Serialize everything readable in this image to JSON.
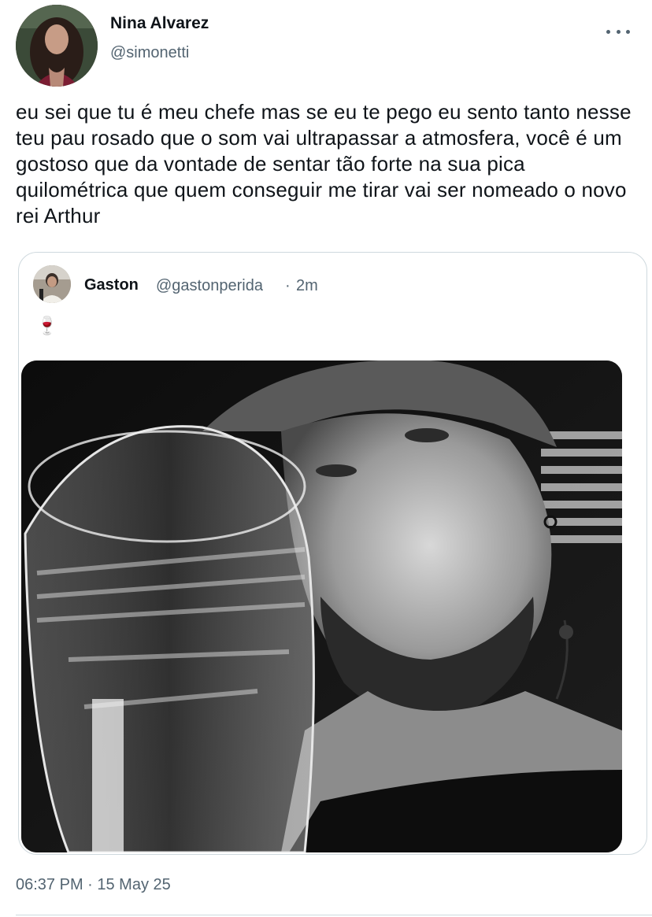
{
  "author": {
    "display_name": "Nina Alvarez",
    "handle": "@simonetti"
  },
  "tweet": {
    "text": "eu sei que tu é meu chefe mas se eu te pego eu sento tanto nesse teu pau rosado que o som vai ultrapassar a atmosfera, você é um gostoso que da vontade de sentar tão forte na sua pica quilométrica que quem conseguir me tirar vai ser nomeado o novo rei Arthur",
    "timestamp": "06:37 PM · 15 May 25"
  },
  "quoted_tweet": {
    "display_name": "Gaston",
    "handle": "@gastonperida",
    "separator": "·",
    "time": "2m",
    "text": "🍷",
    "media_icon": "photo"
  },
  "icons": {
    "more": "more-horizontal-icon",
    "wine": "wine-glass-icon"
  },
  "colors": {
    "primary_text": "#0f1419",
    "secondary_text": "#536471",
    "border": "#cfd9de"
  }
}
